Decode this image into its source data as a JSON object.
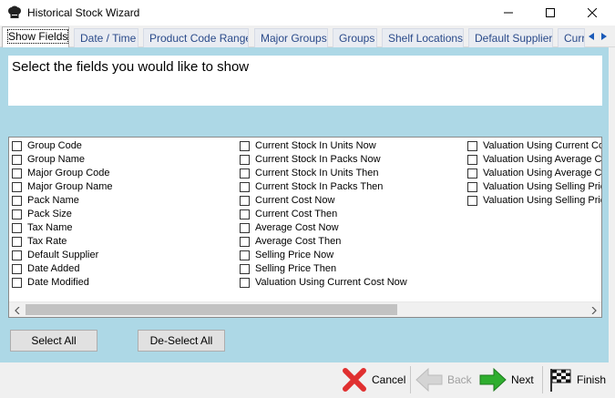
{
  "window": {
    "title": "Historical Stock Wizard"
  },
  "tabs": [
    {
      "label": "Show Fields",
      "active": true
    },
    {
      "label": "Date / Time",
      "active": false
    },
    {
      "label": "Product Code Range",
      "active": false
    },
    {
      "label": "Major Groups",
      "active": false
    },
    {
      "label": "Groups",
      "active": false
    },
    {
      "label": "Shelf Locations",
      "active": false
    },
    {
      "label": "Default Supplier",
      "active": false
    },
    {
      "label": "Curr",
      "active": false
    }
  ],
  "header": {
    "instruction": "Select the fields you would like to show"
  },
  "fields": {
    "col1": [
      "Group Code",
      "Group Name",
      "Major Group Code",
      "Major Group Name",
      "Pack Name",
      "Pack Size",
      "Tax Name",
      "Tax Rate",
      "Default Supplier",
      "Date Added",
      "Date Modified"
    ],
    "col2": [
      "Current Stock In Units Now",
      "Current Stock In Packs Now",
      "Current Stock In Units Then",
      "Current Stock In Packs Then",
      "Current Cost Now",
      "Current Cost Then",
      "Average Cost Now",
      "Average Cost Then",
      "Selling Price Now",
      "Selling Price Then",
      "Valuation Using Current Cost Now"
    ],
    "col3": [
      "Valuation Using Current Co",
      "Valuation Using Average C",
      "Valuation Using Average C",
      "Valuation Using Selling Pric",
      "Valuation Using Selling Pric"
    ]
  },
  "actions": {
    "select_all": "Select All",
    "deselect_all": "De-Select All"
  },
  "footer": {
    "cancel": "Cancel",
    "back": "Back",
    "next": "Next",
    "finish": "Finish"
  },
  "colors": {
    "panel_bg": "#add8e6",
    "tab_text": "#2a4a8a",
    "cancel_icon": "#e03030",
    "next_icon": "#2fae2f"
  },
  "icons": {
    "app": "chef-hat-icon",
    "cancel": "red-x-icon",
    "back": "back-arrow-icon",
    "next": "next-arrow-icon",
    "finish": "checkered-flag-icon"
  }
}
